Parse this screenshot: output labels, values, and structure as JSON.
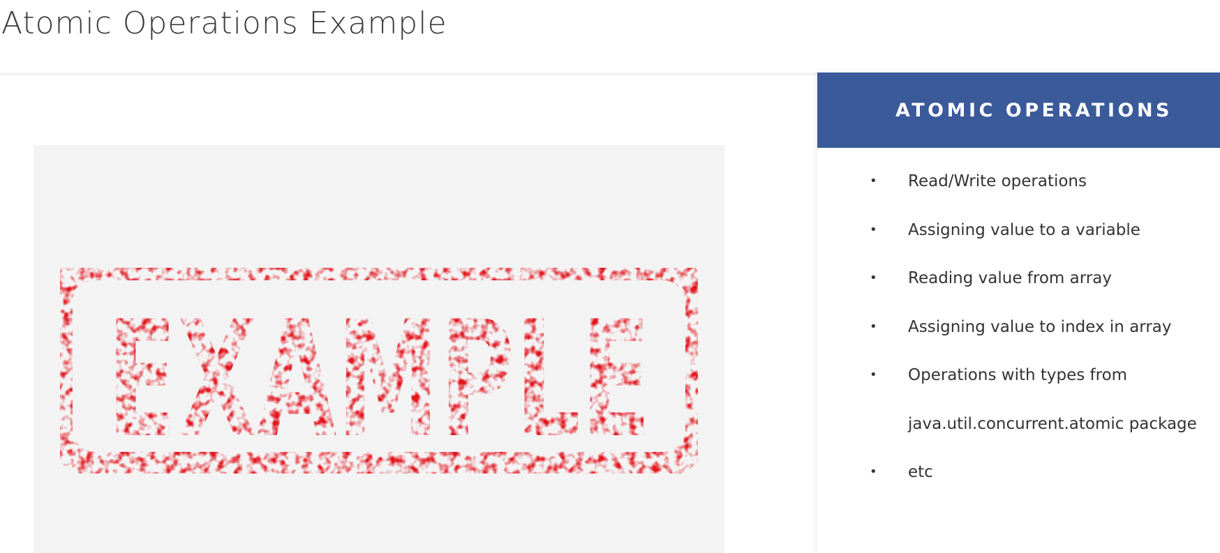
{
  "slide": {
    "title": "Atomic Operations Example"
  },
  "image": {
    "stamp_text": "EXAMPLE",
    "stamp_color": "#e2161f"
  },
  "panel": {
    "header": "ATOMIC OPERATIONS",
    "header_color": "#3a5a9a",
    "bullets": [
      {
        "bullet": "•",
        "text": "Read/Write operations"
      },
      {
        "bullet": "•",
        "text": "Assigning value to a variable"
      },
      {
        "bullet": "•",
        "text": "Reading value from array"
      },
      {
        "bullet": "•",
        "text": "Assigning value to index in array"
      },
      {
        "bullet": "•",
        "text": "Operations with types from"
      },
      {
        "bullet": "",
        "text": "java.util.concurrent.atomic package"
      },
      {
        "bullet": "•",
        "text": "etc"
      }
    ]
  }
}
